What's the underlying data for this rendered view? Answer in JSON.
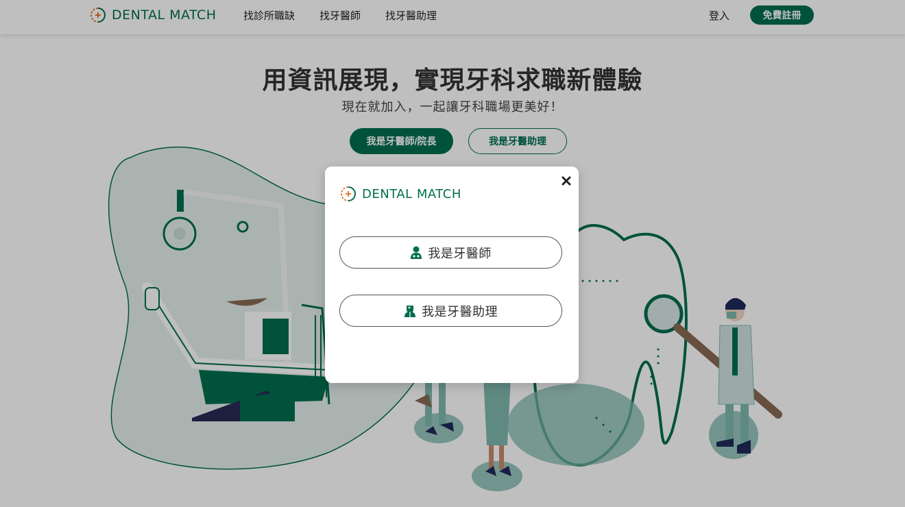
{
  "header": {
    "logo_text": "DENTAL MATCH",
    "nav": [
      "找診所職缺",
      "找牙醫師",
      "找牙醫助理"
    ],
    "login_label": "登入",
    "signup_label": "免費註冊"
  },
  "hero": {
    "title": "用資訊展現，實現牙科求職新體驗",
    "subtitle": "現在就加入，一起讓牙科職場更美好！",
    "dentist_button": "我是牙醫師/院長",
    "assistant_button": "我是牙醫助理"
  },
  "modal": {
    "logo_text": "DENTAL MATCH",
    "close_icon": "close-icon",
    "options": [
      {
        "label": "我是牙醫師",
        "icon": "doctor-icon"
      },
      {
        "label": "我是牙醫助理",
        "icon": "nurse-icon"
      }
    ]
  },
  "colors": {
    "brand": "#006e4f",
    "accent_teal": "#7fb8ae",
    "overlay": "rgba(0,0,0,0.25)"
  }
}
